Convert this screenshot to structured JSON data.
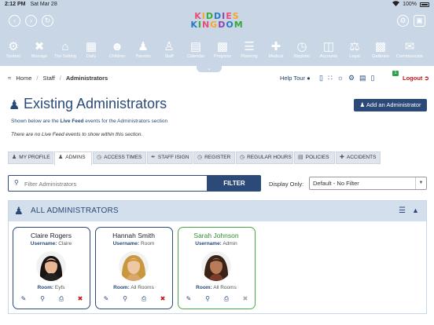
{
  "status_bar": {
    "time": "2:12 PM",
    "date": "Sat Mar 28",
    "battery": "100%"
  },
  "app": {
    "logo_line1": "KIDDIES",
    "logo_line2": "KINGDOM",
    "logo_colors": [
      "#e94e77",
      "#f7a823",
      "#3aaa35",
      "#2b7bc0",
      "#8e44ad"
    ]
  },
  "nav_icons": [
    {
      "label": "System",
      "icon": "gear-icon"
    },
    {
      "label": "Manage",
      "icon": "tools-icon"
    },
    {
      "label": "The Setting",
      "icon": "house-icon"
    },
    {
      "label": "Daily",
      "icon": "calendar-day-icon"
    },
    {
      "label": "Children",
      "icon": "child-icon"
    },
    {
      "label": "Parents",
      "icon": "parents-icon"
    },
    {
      "label": "Staff",
      "icon": "staff-icon"
    },
    {
      "label": "Calendar",
      "icon": "calendar-icon"
    },
    {
      "label": "Progress",
      "icon": "chart-icon"
    },
    {
      "label": "Planning",
      "icon": "planning-icon"
    },
    {
      "label": "Medical",
      "icon": "medical-icon"
    },
    {
      "label": "Register",
      "icon": "clock-icon"
    },
    {
      "label": "Accounts",
      "icon": "accounts-icon"
    },
    {
      "label": "Legal",
      "icon": "scales-icon"
    },
    {
      "label": "Galleries",
      "icon": "gallery-icon"
    },
    {
      "label": "Communicate",
      "icon": "chat-icon"
    }
  ],
  "breadcrumb": {
    "home": "Home",
    "staff": "Staff",
    "current": "Administrators"
  },
  "header_tools": {
    "help_tour": "Help Tour",
    "notification_count": "1",
    "logout": "Logout"
  },
  "page": {
    "title": "Existing Administrators",
    "add_button": "Add an Administrator",
    "livefeed_prefix": "Shown below are the ",
    "livefeed_bold": "Live Feed",
    "livefeed_suffix": " events for the Administrators section",
    "no_events": "There are no Live Feed events to show within this section."
  },
  "tabs": [
    {
      "label": "MY PROFILE",
      "icon": "user-icon"
    },
    {
      "label": "ADMINS",
      "icon": "admin-icon"
    },
    {
      "label": "ACCESS TIMES",
      "icon": "clock-icon"
    },
    {
      "label": "STAFF ISIGN",
      "icon": "sign-icon"
    },
    {
      "label": "REGISTER",
      "icon": "register-icon"
    },
    {
      "label": "REGULAR HOURS",
      "icon": "hours-icon"
    },
    {
      "label": "POLICIES",
      "icon": "policies-icon"
    },
    {
      "label": "ACCIDENTS",
      "icon": "accidents-icon"
    }
  ],
  "filter": {
    "placeholder": "Filter Administrators",
    "button": "FILTER",
    "display_label": "Display Only:",
    "display_value": "Default - No Filter"
  },
  "panel": {
    "title": "ALL ADMINISTRATORS"
  },
  "admins": [
    {
      "name": "Claire Rogers",
      "username_label": "Username:",
      "username": "Claire",
      "room_label": "Room:",
      "room": "Eyfs",
      "status": "active"
    },
    {
      "name": "Hannah Smith",
      "username_label": "Username:",
      "username": "Room",
      "room_label": "Room:",
      "room": "All Rooms",
      "status": "active"
    },
    {
      "name": "Sarah Johnson",
      "username_label": "Username:",
      "username": "Admin",
      "room_label": "Room:",
      "room": "All Rooms",
      "status": "current"
    }
  ]
}
